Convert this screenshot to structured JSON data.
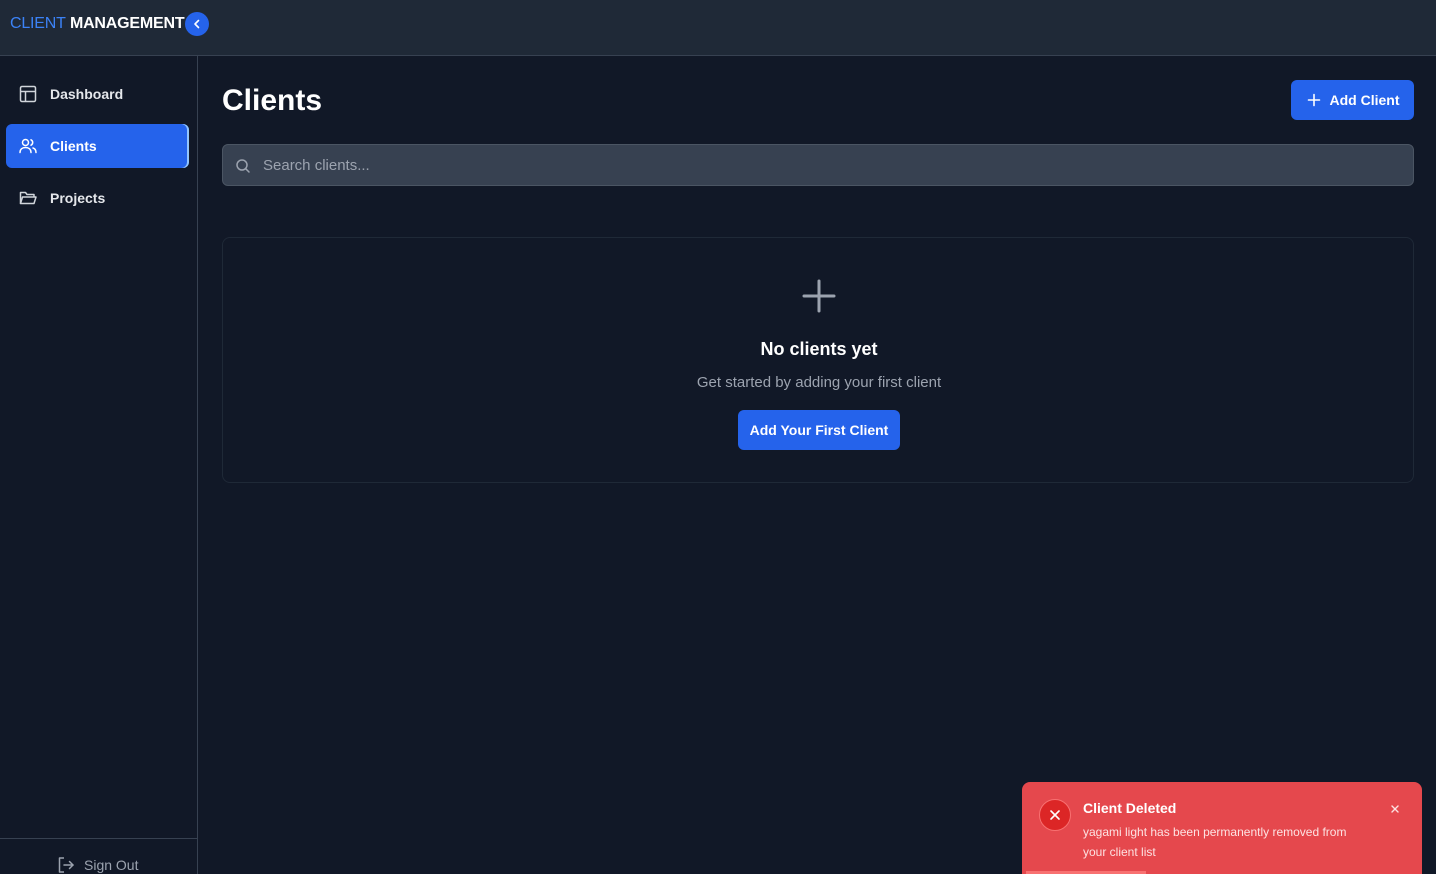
{
  "brand": {
    "accent": "CLIENT",
    "rest": "MANAGEMENT"
  },
  "sidebar": {
    "items": [
      {
        "label": "Dashboard",
        "icon": "layout-icon",
        "active": false
      },
      {
        "label": "Clients",
        "icon": "users-icon",
        "active": true
      },
      {
        "label": "Projects",
        "icon": "folder-icon",
        "active": false
      }
    ],
    "sign_out": "Sign Out"
  },
  "main": {
    "title": "Clients",
    "add_button": "Add Client",
    "search_placeholder": "Search clients...",
    "empty": {
      "title": "No clients yet",
      "subtitle": "Get started by adding your first client",
      "button": "Add Your First Client"
    }
  },
  "toast": {
    "title": "Client Deleted",
    "message": "yagami light has been permanently removed from your client list",
    "progress": 0.3
  },
  "colors": {
    "accent": "#2563eb",
    "background": "#111827",
    "topbar": "#1f2937",
    "toast": "#e5484d"
  }
}
